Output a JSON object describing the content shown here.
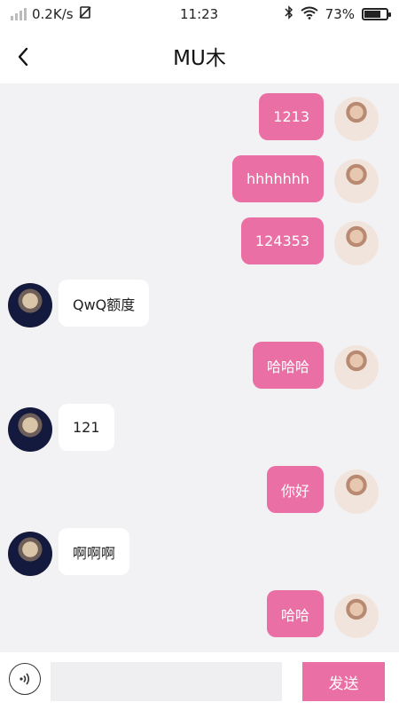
{
  "status_bar": {
    "network_speed": "0.2K/s",
    "time": "11:23",
    "battery_percent": "73%",
    "battery_level": 0.73
  },
  "header": {
    "title": "MU木",
    "back_icon": "chevron-left-icon"
  },
  "messages": [
    {
      "side": "right",
      "text": "1213"
    },
    {
      "side": "right",
      "text": "hhhhhhh"
    },
    {
      "side": "right",
      "text": "124353"
    },
    {
      "side": "left",
      "text": "QwQ额度"
    },
    {
      "side": "right",
      "text": "哈哈哈"
    },
    {
      "side": "left",
      "text": "121"
    },
    {
      "side": "right",
      "text": "你好"
    },
    {
      "side": "left",
      "text": "啊啊啊"
    },
    {
      "side": "right",
      "text": "哈哈"
    }
  ],
  "input_bar": {
    "voice_icon": "voice-icon",
    "placeholder": "",
    "send_label": "发送"
  },
  "colors": {
    "accent": "#ea6fa4",
    "chat_background": "#f2f1f3",
    "left_bubble": "#ffffff"
  }
}
